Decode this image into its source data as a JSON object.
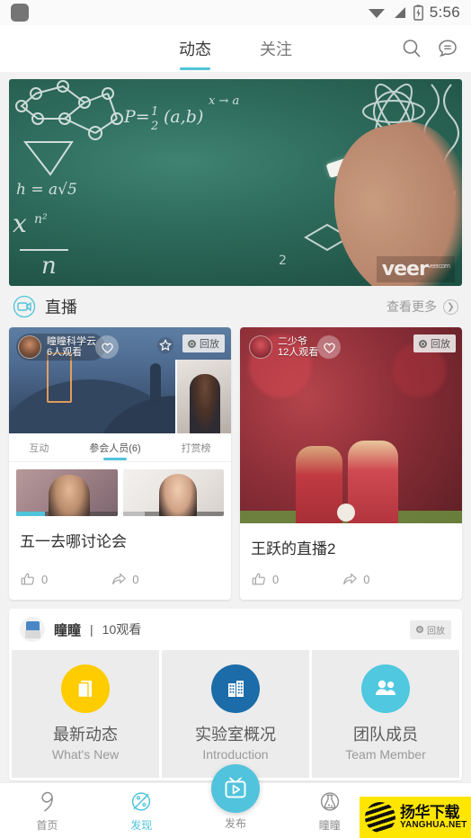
{
  "status_bar": {
    "time": "5:56",
    "icons": [
      "wifi-icon",
      "signal-icon",
      "battery-icon"
    ],
    "app_chip": "app-icon"
  },
  "top_bar": {
    "tabs": [
      {
        "label": "动态",
        "active": true
      },
      {
        "label": "关注",
        "active": false
      }
    ],
    "actions": [
      {
        "name": "search-icon"
      },
      {
        "name": "message-icon"
      }
    ]
  },
  "banner": {
    "name": "chalkboard-banner",
    "watermark": "veer",
    "watermark_sub": "veer.com"
  },
  "live_section": {
    "icon": "live-video-icon",
    "title": "直播",
    "more_label": "查看更多",
    "more_icon": "chevron-right-icon"
  },
  "live_cards": [
    {
      "host_name": "瞳瞳科学云",
      "views": "6人观看",
      "replay_badge": "回放",
      "heart_icon": "heart-icon",
      "star_icon": "star-icon",
      "tabs": [
        {
          "label": "互动",
          "active": false
        },
        {
          "label": "参会人员(6)",
          "active": true
        },
        {
          "label": "打赏榜",
          "active": false
        }
      ],
      "title": "五一去哪讨论会",
      "likes": "0",
      "shares": "0"
    },
    {
      "host_name": "二少爷",
      "views": "12人观看",
      "replay_badge": "回放",
      "heart_icon": "heart-icon",
      "title": "王跃的直播2",
      "likes": "0",
      "shares": "0"
    }
  ],
  "post": {
    "author": "瞳瞳",
    "separator": "|",
    "views": "10观看",
    "replay_badge": "回放",
    "features": [
      {
        "cn": "最新动态",
        "en": "What's New",
        "icon": "book-icon",
        "color": "#ffcc00"
      },
      {
        "cn": "实验室概况",
        "en": "Introduction",
        "icon": "building-icon",
        "color": "#1b6ca8"
      },
      {
        "cn": "团队成员",
        "en": "Team Member",
        "icon": "people-icon",
        "color": "#4fc8e0"
      }
    ]
  },
  "bottom_nav": {
    "items": [
      {
        "label": "首页",
        "icon": "home-icon",
        "active": false
      },
      {
        "label": "发现",
        "icon": "discover-icon",
        "active": true
      },
      {
        "label": "发布",
        "icon": "publish-icon",
        "active": false
      },
      {
        "label": "瞳瞳",
        "icon": "flask-icon",
        "active": false
      },
      {
        "label": "",
        "icon": "profile-icon",
        "active": false
      }
    ],
    "fab_label": "发布"
  },
  "watermark": {
    "cn": "扬华下载",
    "en": "YANGHUA.NET"
  },
  "colors": {
    "accent": "#4fc3d9",
    "board_green": "#2e6b5c",
    "yellow": "#ffcc00",
    "blue": "#1b6ca8",
    "cyan": "#4fc8e0",
    "watermark_yellow": "#ffe600"
  }
}
